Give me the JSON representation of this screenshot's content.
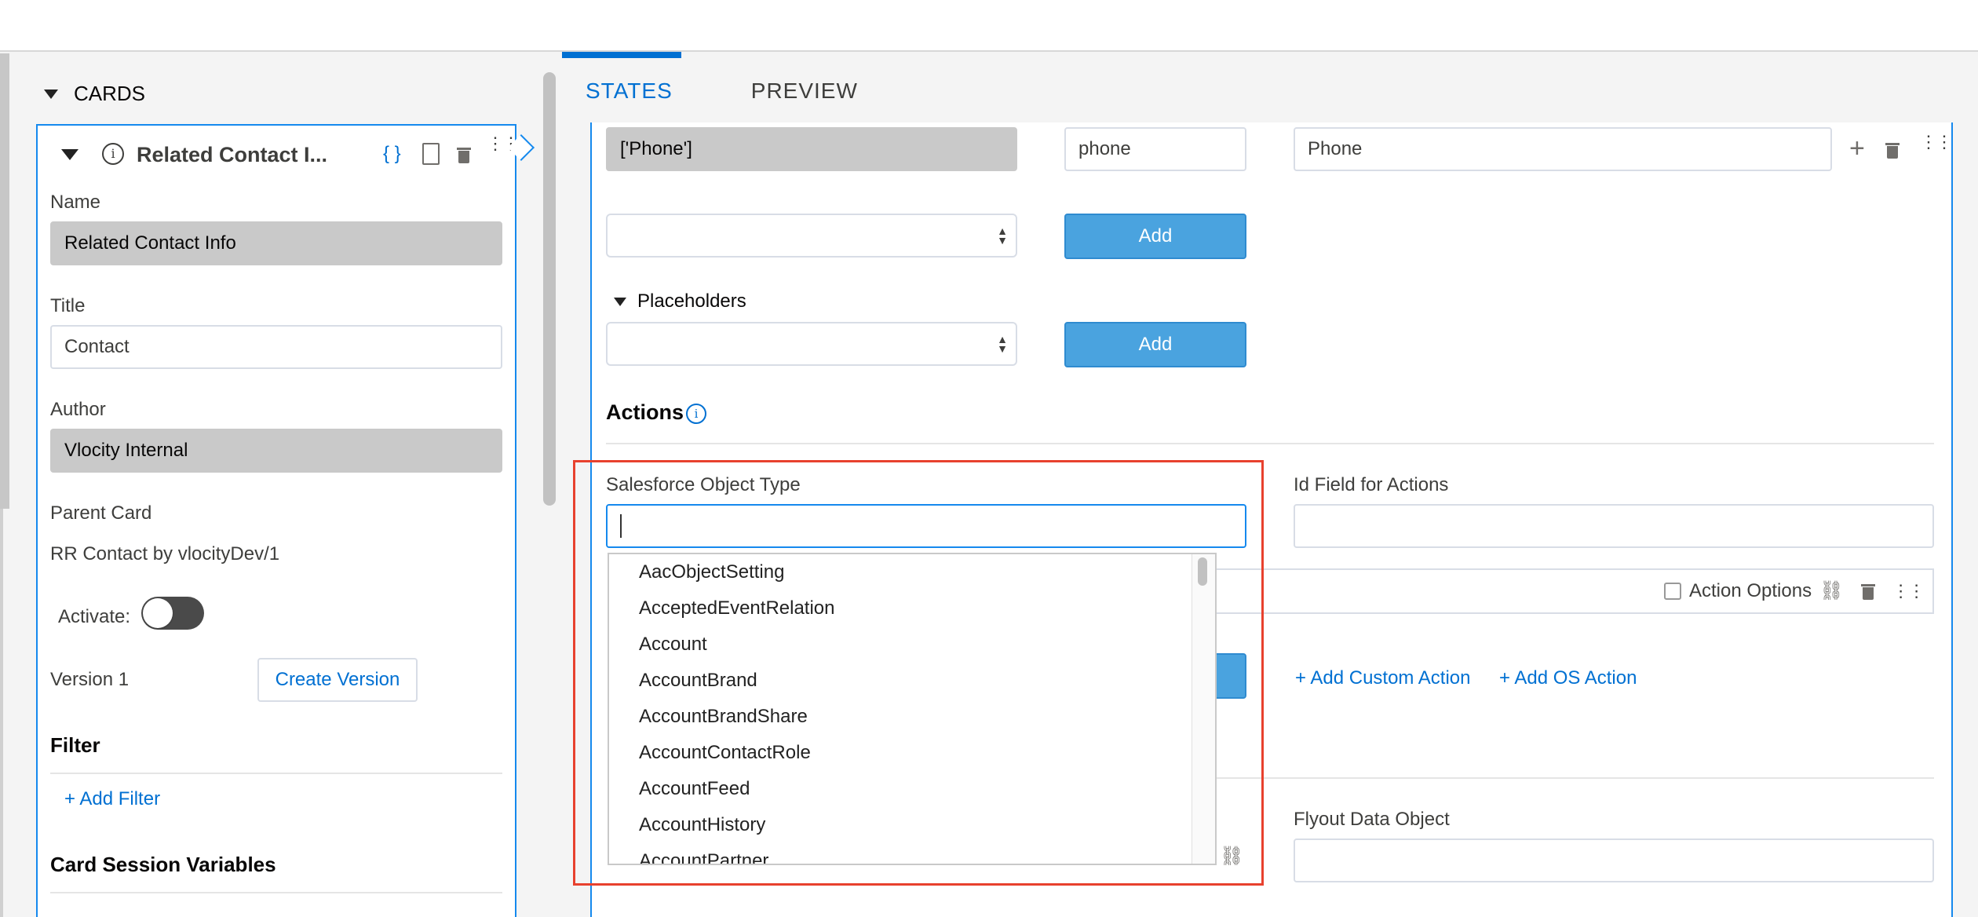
{
  "left": {
    "section_title": "CARDS",
    "card": {
      "header_title": "Related Contact I...",
      "json_icon": "{ }",
      "name_label": "Name",
      "name_value": "Related Contact Info",
      "title_label": "Title",
      "title_value": "Contact",
      "author_label": "Author",
      "author_value": "Vlocity Internal",
      "parent_label": "Parent Card",
      "parent_value": "RR Contact by vlocityDev/1",
      "activate_label": "Activate:",
      "version_label": "Version 1",
      "create_version": "Create Version",
      "filter_heading": "Filter",
      "add_filter": "+ Add Filter",
      "session_heading": "Card Session Variables"
    }
  },
  "tabs": [
    "STATES",
    "PREVIEW"
  ],
  "main": {
    "phone_field_value": "['Phone']",
    "phone_key": "phone",
    "phone_label": "Phone",
    "add_label": "Add",
    "add_label2": "Add",
    "placeholders_label": "Placeholders",
    "actions_heading": "Actions",
    "sf_object_label": "Salesforce Object Type",
    "sf_object_value": "",
    "id_field_label": "Id Field for Actions",
    "action_options_label": "Action Options",
    "add_custom_action": "+ Add Custom Action",
    "add_os_action": "+ Add OS Action",
    "flyout_label": "Flyout Data Object",
    "dropdown_items": [
      "AacObjectSetting",
      "AcceptedEventRelation",
      "Account",
      "AccountBrand",
      "AccountBrandShare",
      "AccountContactRole",
      "AccountFeed",
      "AccountHistory",
      "AccountPartner"
    ]
  },
  "colors": {
    "accent": "#0070d2",
    "highlight_box": "#e8412e",
    "button": "#4aa3df"
  }
}
